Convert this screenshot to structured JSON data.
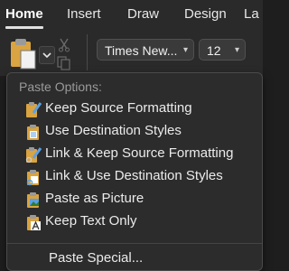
{
  "tabs": [
    {
      "label": "Home",
      "active": true
    },
    {
      "label": "Insert"
    },
    {
      "label": "Draw"
    },
    {
      "label": "Design"
    },
    {
      "label": "La"
    }
  ],
  "toolbar": {
    "font_name": "Times New...",
    "font_size": "12",
    "icons": [
      "paste-icon",
      "cut-icon",
      "copy-icon"
    ]
  },
  "menu": {
    "header": "Paste Options:",
    "items": [
      {
        "label": "Keep Source Formatting",
        "icon": "keep-source-formatting-icon"
      },
      {
        "label": "Use Destination Styles",
        "icon": "use-destination-styles-icon"
      },
      {
        "label": "Link & Keep Source Formatting",
        "icon": "link-keep-source-formatting-icon"
      },
      {
        "label": "Link & Use Destination Styles",
        "icon": "link-use-destination-styles-icon"
      },
      {
        "label": "Paste as Picture",
        "icon": "paste-as-picture-icon"
      },
      {
        "label": "Keep Text Only",
        "icon": "keep-text-only-icon"
      }
    ],
    "special": "Paste Special..."
  },
  "colors": {
    "background": "#1e1e1e",
    "menu": "#2c2c2c",
    "clipboard": "#d9a441",
    "brush": "#5aa0e6"
  }
}
